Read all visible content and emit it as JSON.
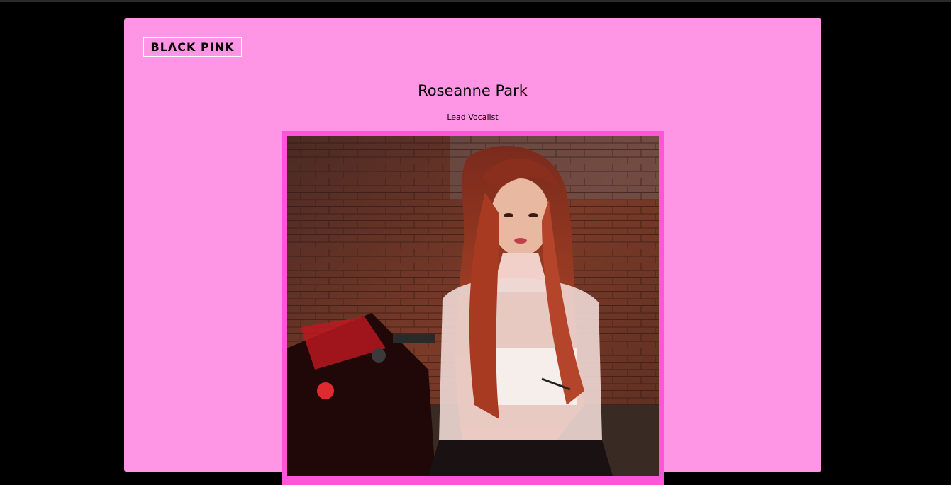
{
  "logo": {
    "text": "BLΛCK PINK"
  },
  "profile": {
    "name": "Roseanne Park",
    "role": "Lead Vocalist",
    "photo_alt": "Roseanne Park"
  },
  "colors": {
    "page_background": "#000000",
    "card_background": "#ff95e4",
    "photo_border": "#ff55d6"
  }
}
